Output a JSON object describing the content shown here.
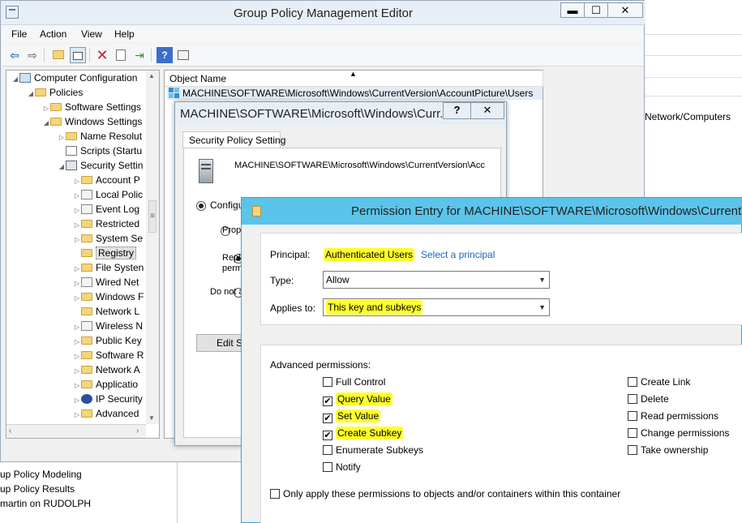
{
  "main_window": {
    "title": "Group Policy Management Editor",
    "min_label": "▬",
    "max_label": "☐",
    "close_label": "✕"
  },
  "menu": {
    "items": [
      "File",
      "Action",
      "View",
      "Help"
    ]
  },
  "tree": {
    "items": [
      {
        "label": "Computer Configuration",
        "indent": 0,
        "expander": "◢",
        "icon": "computer"
      },
      {
        "label": "Policies",
        "indent": 1,
        "expander": "◢",
        "icon": "folder"
      },
      {
        "label": "Software Settings",
        "indent": 2,
        "expander": "▷",
        "icon": "folder"
      },
      {
        "label": "Windows Settings",
        "indent": 2,
        "expander": "◢",
        "icon": "folder"
      },
      {
        "label": "Name Resolut",
        "indent": 3,
        "expander": "▷",
        "icon": "folder"
      },
      {
        "label": "Scripts (Startu",
        "indent": 3,
        "expander": "",
        "icon": "script"
      },
      {
        "label": "Security Settin",
        "indent": 3,
        "expander": "◢",
        "icon": "security"
      },
      {
        "label": "Account P",
        "indent": 4,
        "expander": "▷",
        "icon": "folder"
      },
      {
        "label": "Local Polic",
        "indent": 4,
        "expander": "▷",
        "icon": "policy"
      },
      {
        "label": "Event Log",
        "indent": 4,
        "expander": "▷",
        "icon": "policy"
      },
      {
        "label": "Restricted",
        "indent": 4,
        "expander": "▷",
        "icon": "folder"
      },
      {
        "label": "System Se",
        "indent": 4,
        "expander": "▷",
        "icon": "folder"
      },
      {
        "label": "Registry",
        "indent": 4,
        "expander": "",
        "icon": "folder",
        "selected": true
      },
      {
        "label": "File Systen",
        "indent": 4,
        "expander": "▷",
        "icon": "folder"
      },
      {
        "label": "Wired Net",
        "indent": 4,
        "expander": "▷",
        "icon": "policy"
      },
      {
        "label": "Windows F",
        "indent": 4,
        "expander": "▷",
        "icon": "folder"
      },
      {
        "label": "Network L",
        "indent": 4,
        "expander": "",
        "icon": "folder"
      },
      {
        "label": "Wireless N",
        "indent": 4,
        "expander": "▷",
        "icon": "policy"
      },
      {
        "label": "Public Key",
        "indent": 4,
        "expander": "▷",
        "icon": "folder"
      },
      {
        "label": "Software R",
        "indent": 4,
        "expander": "▷",
        "icon": "folder"
      },
      {
        "label": "Network A",
        "indent": 4,
        "expander": "▷",
        "icon": "folder"
      },
      {
        "label": "Applicatio",
        "indent": 4,
        "expander": "▷",
        "icon": "folder"
      },
      {
        "label": "IP Security",
        "indent": 4,
        "expander": "▷",
        "icon": "ipsec"
      },
      {
        "label": "Advanced",
        "indent": 4,
        "expander": "▷",
        "icon": "folder"
      }
    ]
  },
  "list": {
    "column_header": "Object Name",
    "rows": [
      "MACHINE\\SOFTWARE\\Microsoft\\Windows\\CurrentVersion\\AccountPicture\\Users"
    ]
  },
  "background_right": {
    "fragment": "Network/Computers"
  },
  "bottom_pane": {
    "items": [
      "up Policy Modeling",
      "up Policy Results",
      "martin on RUDOLPH"
    ]
  },
  "prop_dialog": {
    "title": "MACHINE\\SOFTWARE\\Microsoft\\Windows\\Curr...",
    "help_label": "?",
    "close_label": "✕",
    "tab": "Security Policy Setting",
    "path": "MACHINE\\SOFTWARE\\Microsoft\\Windows\\CurrentVersion\\Acc",
    "option_configure": "Configu",
    "option_propagate": "Propa",
    "option_replace": "Repl",
    "option_replace_line2": "perm",
    "option_donot": "Do not a",
    "edit_button": "Edit Se"
  },
  "perm_dialog": {
    "title": "Permission Entry for MACHINE\\SOFTWARE\\Microsoft\\Windows\\CurrentV",
    "principal_label": "Principal:",
    "principal_value": "Authenticated Users",
    "select_principal": "Select a principal",
    "type_label": "Type:",
    "type_value": "Allow",
    "applies_label": "Applies to:",
    "applies_value": "This key and subkeys",
    "advanced_label": "Advanced permissions:",
    "left_perms": [
      {
        "label": "Full Control",
        "checked": false,
        "highlight": false
      },
      {
        "label": "Query Value",
        "checked": true,
        "highlight": true
      },
      {
        "label": "Set Value",
        "checked": true,
        "highlight": true
      },
      {
        "label": "Create Subkey",
        "checked": true,
        "highlight": true
      },
      {
        "label": "Enumerate Subkeys",
        "checked": false,
        "highlight": false
      },
      {
        "label": "Notify",
        "checked": false,
        "highlight": false
      }
    ],
    "right_perms": [
      {
        "label": "Create Link",
        "checked": false
      },
      {
        "label": "Delete",
        "checked": false
      },
      {
        "label": "Read permissions",
        "checked": false
      },
      {
        "label": "Change permissions",
        "checked": false
      },
      {
        "label": "Take ownership",
        "checked": false
      }
    ],
    "only_apply": "Only apply these permissions to objects and/or containers within this container"
  },
  "colors": {
    "highlight": "#ffff2d",
    "perm_titlebar": "#5bc4ea",
    "link": "#1a65c0"
  }
}
